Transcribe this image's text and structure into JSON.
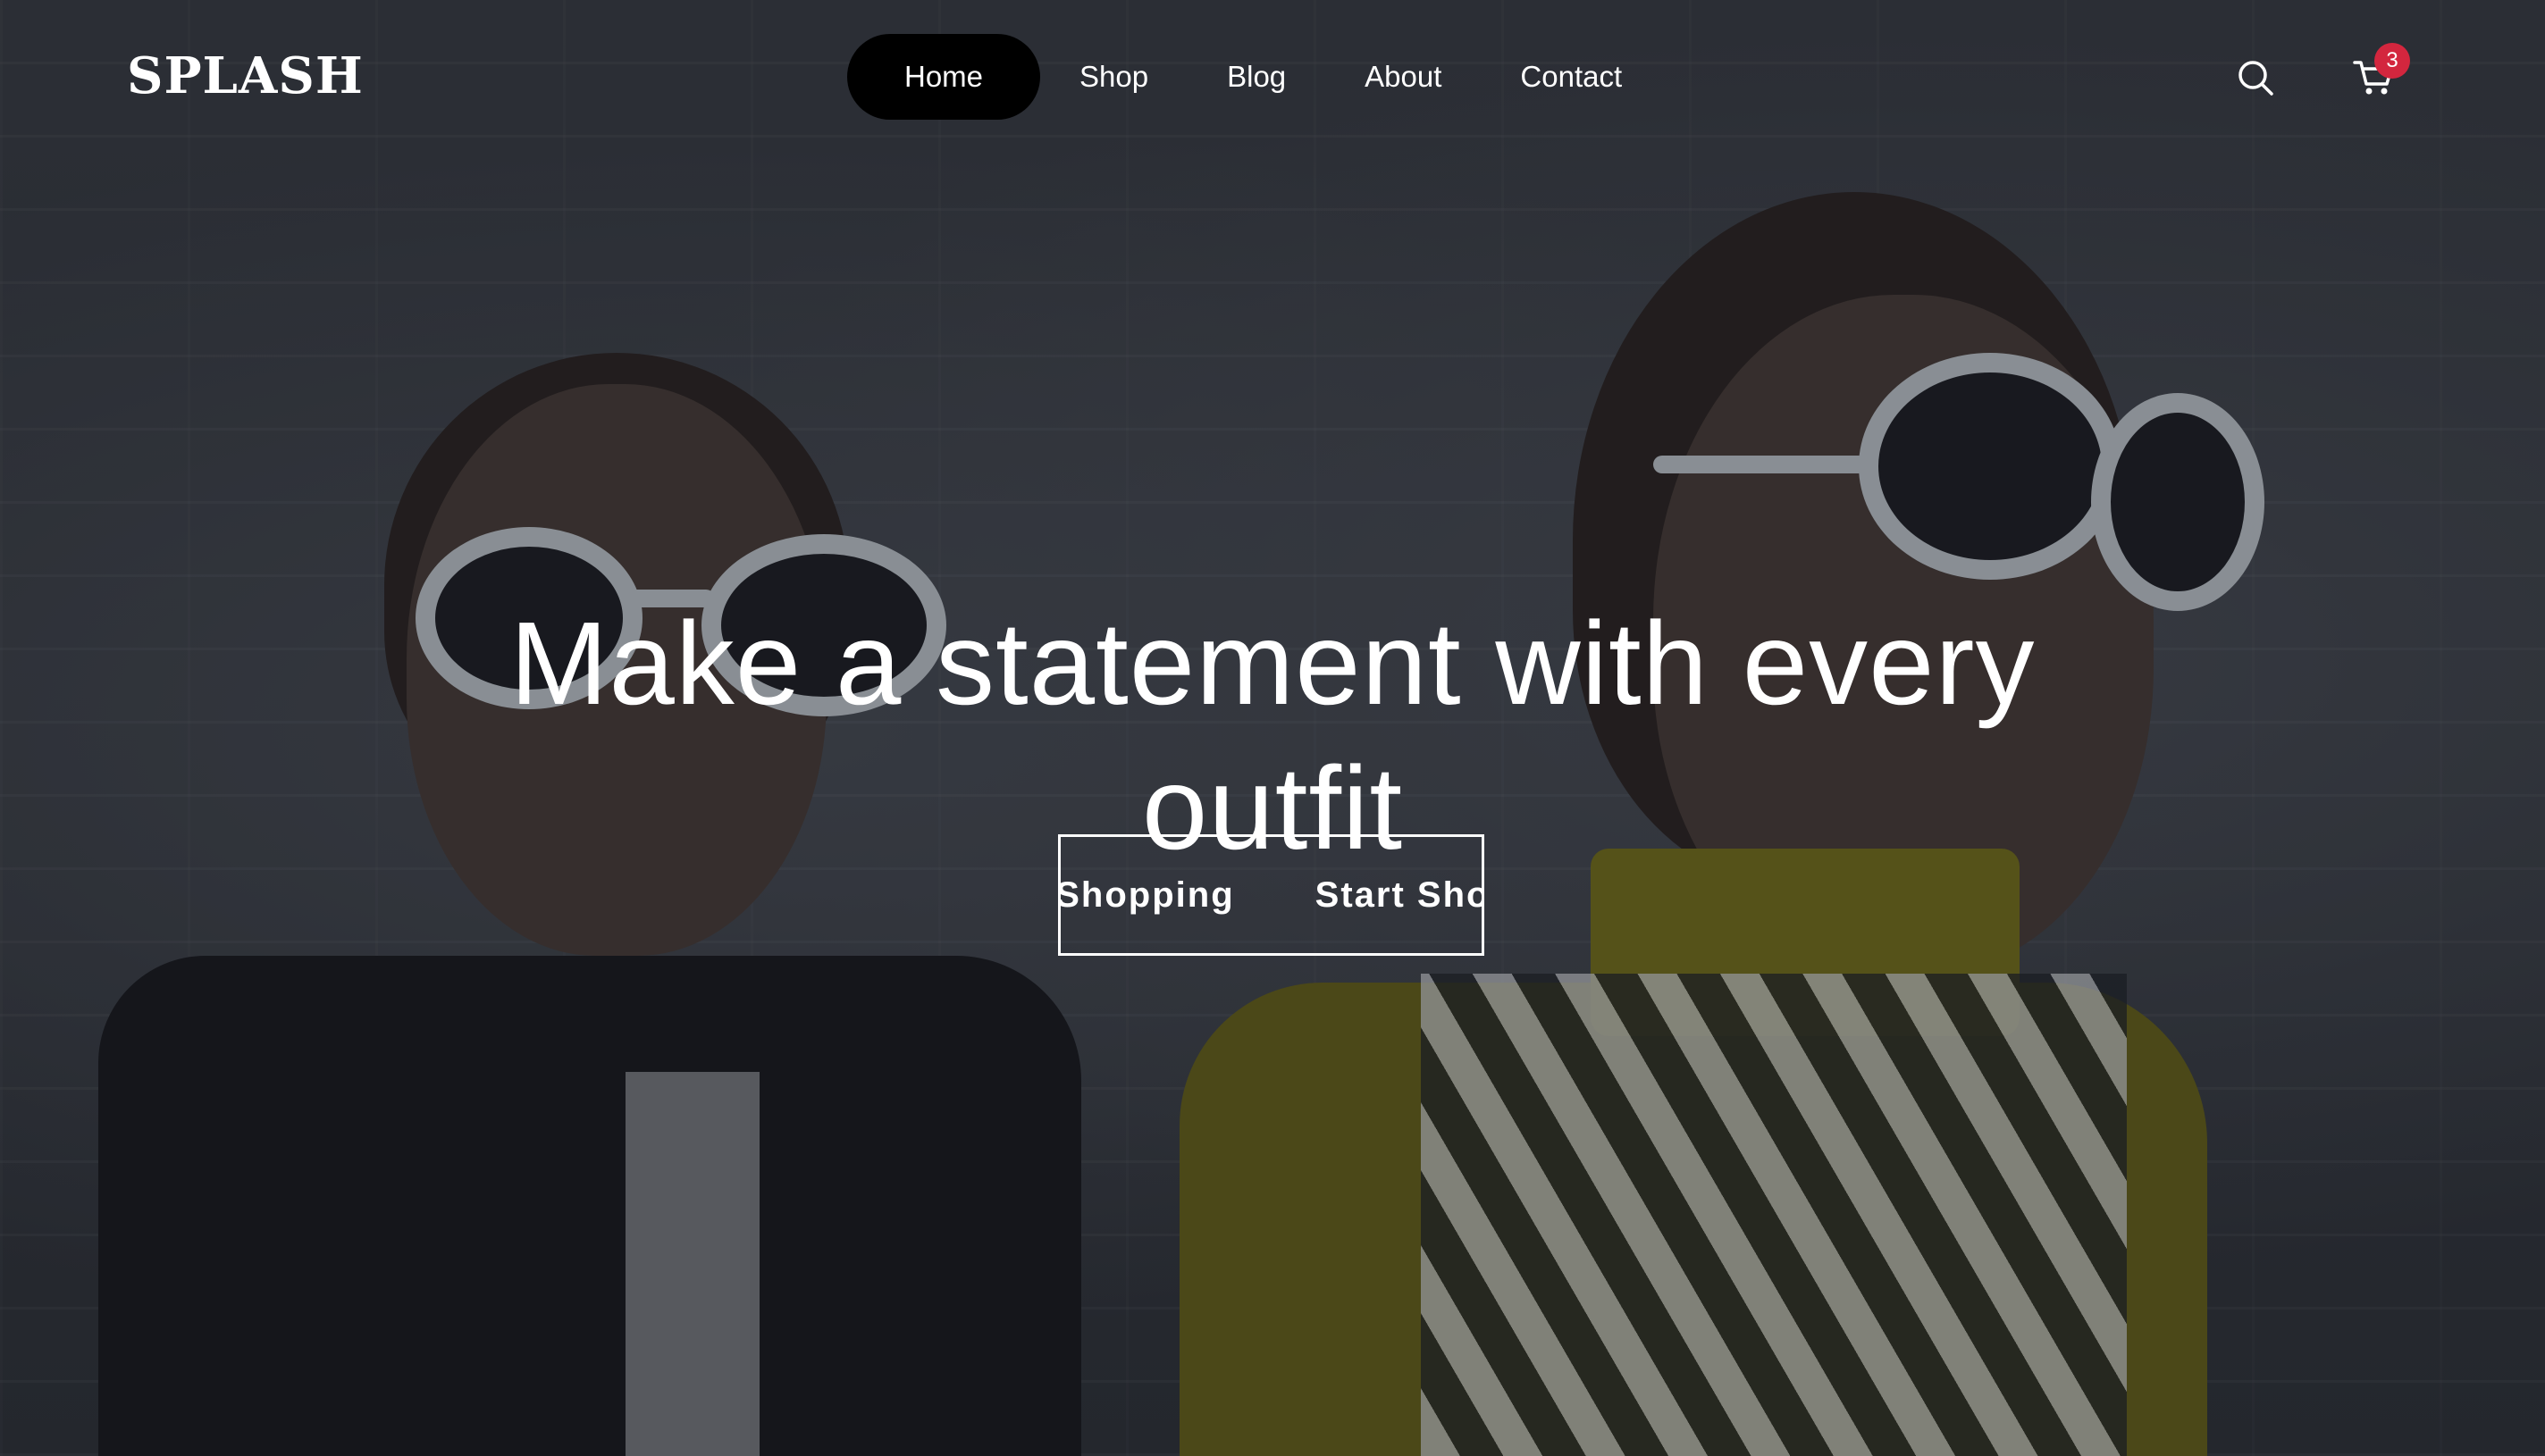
{
  "brand": {
    "logo": "SPLASH"
  },
  "nav": {
    "items": [
      {
        "label": "Home",
        "active": true
      },
      {
        "label": "Shop",
        "active": false
      },
      {
        "label": "Blog",
        "active": false
      },
      {
        "label": "About",
        "active": false
      },
      {
        "label": "Contact",
        "active": false
      }
    ]
  },
  "header_actions": {
    "search_icon": "search-icon",
    "cart_icon": "cart-icon",
    "cart_count": "3"
  },
  "hero": {
    "headline_line1": "Make a statement with every",
    "headline_line2": "outfit",
    "cta_label": "Start Shopping"
  },
  "colors": {
    "nav_active_bg": "#000000",
    "badge": "#d3263e",
    "text": "#ffffff"
  }
}
